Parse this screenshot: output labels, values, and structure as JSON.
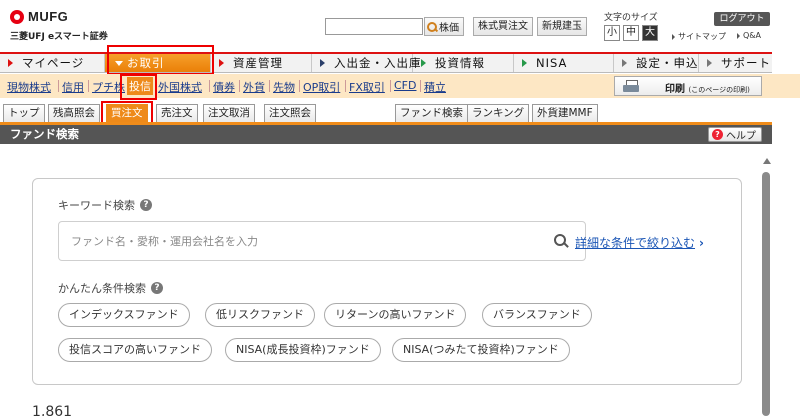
{
  "brand": {
    "logo": "MUFG",
    "subtitle": "三菱UFJ eスマート証券"
  },
  "header": {
    "search_button": "株価",
    "quick_buttons": [
      "株式買注文",
      "新規建玉"
    ],
    "font_size_label": "文字のサイズ",
    "font_sizes": [
      "小",
      "中",
      "大"
    ],
    "font_size_active": "大",
    "logout": "ログアウト",
    "links": [
      "サイトマップ",
      "Q&A"
    ]
  },
  "global_nav": {
    "items": [
      "マイページ",
      "お取引",
      "資産管理",
      "入出金・入出庫",
      "投資情報",
      "NISA",
      "設定・申込",
      "サポート"
    ],
    "active": "お取引"
  },
  "sub_nav": {
    "items": [
      "現物株式",
      "信用",
      "プチ株",
      "投信",
      "外国株式",
      "債券",
      "外貨",
      "先物",
      "OP取引",
      "FX取引",
      "CFD",
      "積立"
    ],
    "active": "投信",
    "print_label": "印刷",
    "print_note": "(このページの印刷)"
  },
  "tabs": {
    "left": [
      "トップ",
      "残高照会",
      "買注文",
      "売注文",
      "注文取消",
      "注文照会"
    ],
    "right": [
      "ファンド検索",
      "ランキング",
      "外貨建MMF"
    ],
    "active": "買注文"
  },
  "section": {
    "title": "ファンド検索",
    "help": "ヘルプ"
  },
  "search": {
    "keyword_label": "キーワード検索",
    "placeholder": "ファンド名・愛称・運用会社名を入力",
    "detail_link": "詳細な条件で絞り込む",
    "easy_label": "かんたん条件検索",
    "chips": [
      "インデックスファンド",
      "低リスクファンド",
      "リターンの高いファンド",
      "バランスファンド",
      "投信スコアの高いファンド",
      "NISA(成長投資枠)ファンド",
      "NISA(つみたて投資枠)ファンド"
    ]
  },
  "results": {
    "count": "1,861"
  },
  "colors": {
    "brand_red": "#e60012",
    "accent_orange": "#ee8a1a",
    "link_blue": "#1a55b5",
    "section_bar": "#555555",
    "highlight_box": "#ee0000"
  }
}
